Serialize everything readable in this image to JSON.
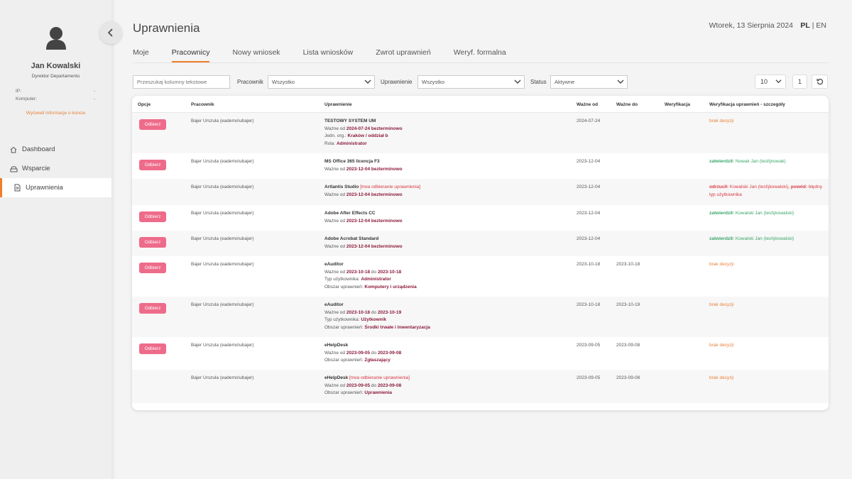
{
  "sidebar": {
    "user_name": "Jan Kowalski",
    "user_role": "Dyrektor Departamentu",
    "ip_label": "IP:",
    "ip_value": "-",
    "computer_label": "Komputer:",
    "computer_value": "-",
    "account_link": "Wyświetl informacje o koncie",
    "nav": [
      {
        "label": "Dashboard",
        "icon": "home-icon"
      },
      {
        "label": "Wsparcie",
        "icon": "support-icon"
      },
      {
        "label": "Uprawnienia",
        "icon": "document-icon",
        "active": true
      }
    ]
  },
  "header": {
    "title": "Uprawnienia",
    "date": "Wtorek, 13 Sierpnia 2024",
    "lang_pl": "PL",
    "lang_sep": "|",
    "lang_en": "EN"
  },
  "tabs": [
    "Moje",
    "Pracownicy",
    "Nowy wniosek",
    "Lista wniosków",
    "Zwrot uprawnień",
    "Weryf. formalna"
  ],
  "active_tab": "Pracownicy",
  "filters": {
    "search_placeholder": "Przeszukaj kolumny tekstowe",
    "employee_label": "Pracownik",
    "employee_value": "Wszystko",
    "permission_label": "Uprawnienie",
    "permission_value": "Wszystko",
    "status_label": "Status",
    "status_value": "Aktywne",
    "per_page": "10",
    "page": "1"
  },
  "table": {
    "headers": [
      "Opcje",
      "Pracownik",
      "Uprawnienie",
      "Ważne od",
      "Ważne do",
      "Weryfikacja",
      "Weryfikacja uprawnień - szczegóły"
    ],
    "revoke_label": "Odbierz",
    "rows": [
      {
        "revoke": true,
        "employee": "Bajer Urszula (eademo\\ubajer)",
        "perm_lines": [
          [
            {
              "t": "TESTOWY SYSTEM UM",
              "c": "title"
            }
          ],
          [
            {
              "t": "Ważne od "
            },
            {
              "t": "2024-07-24 bezterminowo",
              "c": "hl"
            }
          ],
          [
            {
              "t": "Jedn. org.: "
            },
            {
              "t": "Kraków / oddział b",
              "c": "hl"
            }
          ],
          [
            {
              "t": "Rola: "
            },
            {
              "t": "Administrator",
              "c": "hl"
            }
          ]
        ],
        "valid_from": "2024-07-24",
        "valid_to": "",
        "verification": "",
        "details": [
          {
            "t": "brak decyzji",
            "c": "orange"
          }
        ]
      },
      {
        "revoke": true,
        "employee": "Bajer Urszula (eademo\\ubajer)",
        "perm_lines": [
          [
            {
              "t": "MS Office 365 licencja F3",
              "c": "title"
            }
          ],
          [
            {
              "t": "Ważne od "
            },
            {
              "t": "2023-12-04 bezterminowo",
              "c": "hl"
            }
          ]
        ],
        "valid_from": "2023-12-04",
        "valid_to": "",
        "verification": "",
        "details": [
          {
            "t": "zatwierdził: ",
            "c": "green-b"
          },
          {
            "t": "Nowak Jan (test\\jnowak)",
            "c": "green"
          }
        ]
      },
      {
        "revoke": false,
        "employee": "Bajer Urszula (eademo\\ubajer)",
        "perm_lines": [
          [
            {
              "t": "Artlantis Studio ",
              "c": "title"
            },
            {
              "t": "[trwa odbieranie uprawnienia]",
              "c": "warn"
            }
          ],
          [
            {
              "t": "Ważne od "
            },
            {
              "t": "2023-12-04 bezterminowo",
              "c": "hl"
            }
          ]
        ],
        "valid_from": "2023-12-04",
        "valid_to": "",
        "verification": "",
        "details": [
          {
            "t": "odrzucił: ",
            "c": "red-b"
          },
          {
            "t": "Kowalski Jan (test\\jkowalski), ",
            "c": "red"
          },
          {
            "t": "powód: ",
            "c": "red-b"
          },
          {
            "t": "błędny typ użytkownika",
            "c": "red"
          }
        ]
      },
      {
        "revoke": true,
        "employee": "Bajer Urszula (eademo\\ubajer)",
        "perm_lines": [
          [
            {
              "t": "Adobe After Effects CC",
              "c": "title"
            }
          ],
          [
            {
              "t": "Ważne od "
            },
            {
              "t": "2023-12-04 bezterminowo",
              "c": "hl"
            }
          ]
        ],
        "valid_from": "2023-12-04",
        "valid_to": "",
        "verification": "",
        "details": [
          {
            "t": "zatwierdził: ",
            "c": "green-b"
          },
          {
            "t": "Kowalski Jan (test\\jkowalski)",
            "c": "green"
          }
        ]
      },
      {
        "revoke": true,
        "employee": "Bajer Urszula (eademo\\ubajer)",
        "perm_lines": [
          [
            {
              "t": "Adobe Acrobat Standard",
              "c": "title"
            }
          ],
          [
            {
              "t": "Ważne od "
            },
            {
              "t": "2023-12-04 bezterminowo",
              "c": "hl"
            }
          ]
        ],
        "valid_from": "2023-12-04",
        "valid_to": "",
        "verification": "",
        "details": [
          {
            "t": "zatwierdził: ",
            "c": "green-b"
          },
          {
            "t": "Kowalski Jan (test\\jkowalski)",
            "c": "green"
          }
        ]
      },
      {
        "revoke": true,
        "employee": "Bajer Urszula (eademo\\ubajer)",
        "perm_lines": [
          [
            {
              "t": "eAuditor",
              "c": "title"
            }
          ],
          [
            {
              "t": "Ważne od "
            },
            {
              "t": "2023-10-18",
              "c": "hl"
            },
            {
              "t": " do "
            },
            {
              "t": "2023-10-18",
              "c": "hl"
            }
          ],
          [
            {
              "t": "Typ użytkownika: "
            },
            {
              "t": "Administrator",
              "c": "hl"
            }
          ],
          [
            {
              "t": "Obszar uprawnień: "
            },
            {
              "t": "Komputery i urządzenia",
              "c": "hl"
            }
          ]
        ],
        "valid_from": "2023-10-18",
        "valid_to": "2023-10-18",
        "verification": "",
        "details": [
          {
            "t": "brak decyzji",
            "c": "orange"
          }
        ]
      },
      {
        "revoke": true,
        "employee": "Bajer Urszula (eademo\\ubajer)",
        "perm_lines": [
          [
            {
              "t": "eAuditor",
              "c": "title"
            }
          ],
          [
            {
              "t": "Ważne od "
            },
            {
              "t": "2023-10-18",
              "c": "hl"
            },
            {
              "t": " do "
            },
            {
              "t": "2023-10-19",
              "c": "hl"
            }
          ],
          [
            {
              "t": "Typ użytkownika: "
            },
            {
              "t": "Użytkownik",
              "c": "hl"
            }
          ],
          [
            {
              "t": "Obszar uprawnień: "
            },
            {
              "t": "Środki trwałe i inwentaryzacja",
              "c": "hl"
            }
          ]
        ],
        "valid_from": "2023-10-18",
        "valid_to": "2023-10-19",
        "verification": "",
        "details": [
          {
            "t": "brak decyzji",
            "c": "orange"
          }
        ]
      },
      {
        "revoke": true,
        "employee": "Bajer Urszula (eademo\\ubajer)",
        "perm_lines": [
          [
            {
              "t": "eHelpDesk",
              "c": "title"
            }
          ],
          [
            {
              "t": "Ważne od "
            },
            {
              "t": "2023-09-05",
              "c": "hl"
            },
            {
              "t": " do "
            },
            {
              "t": "2023-09-08",
              "c": "hl"
            }
          ],
          [
            {
              "t": "Obszar uprawnień: "
            },
            {
              "t": "Zgłaszający",
              "c": "hl"
            }
          ]
        ],
        "valid_from": "2023-09-05",
        "valid_to": "2023-09-08",
        "verification": "",
        "details": [
          {
            "t": "brak decyzji",
            "c": "orange"
          }
        ]
      },
      {
        "revoke": false,
        "employee": "Bajer Urszula (eademo\\ubajer)",
        "perm_lines": [
          [
            {
              "t": "eHelpDesk ",
              "c": "title"
            },
            {
              "t": "[trwa odbieranie uprawnienia]",
              "c": "warn"
            }
          ],
          [
            {
              "t": "Ważne od "
            },
            {
              "t": "2023-09-05",
              "c": "hl"
            },
            {
              "t": " do "
            },
            {
              "t": "2023-09-08",
              "c": "hl"
            }
          ],
          [
            {
              "t": "Obszar uprawnień: "
            },
            {
              "t": "Uprawnienia",
              "c": "hl"
            }
          ]
        ],
        "valid_from": "2023-09-05",
        "valid_to": "2023-09-08",
        "verification": "",
        "details": [
          {
            "t": "brak decyzji",
            "c": "orange"
          }
        ]
      }
    ]
  },
  "colors": {
    "accent": "#f07d2a",
    "revoke_button": "#ee6b8a",
    "highlight": "#8b1a3a",
    "approved": "#3aa56a",
    "rejected": "#d9363e",
    "pending": "#e8823a"
  }
}
